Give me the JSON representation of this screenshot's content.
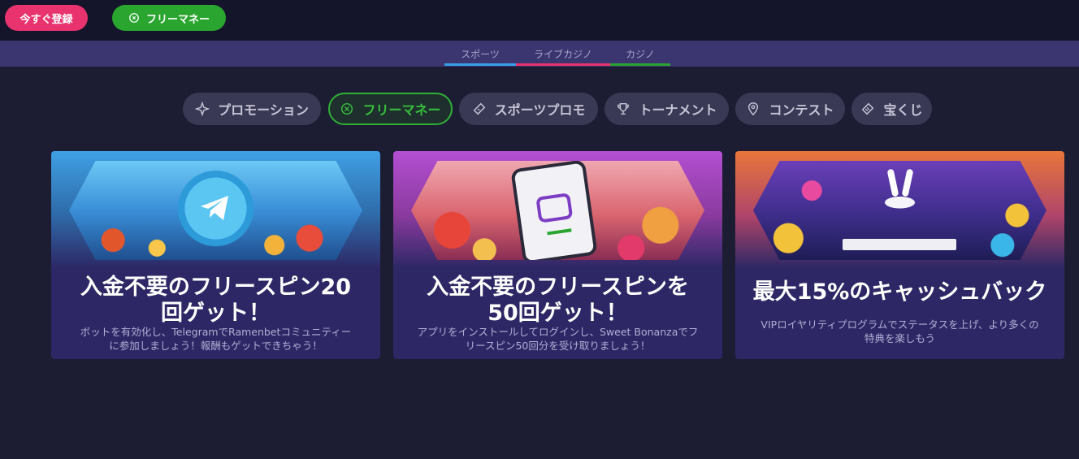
{
  "header": {
    "register_label": "今すぐ登録",
    "freemoney_label": "フリーマネー"
  },
  "nav": {
    "tabs": [
      {
        "label": "スポーツ",
        "color": "#3aa0e8"
      },
      {
        "label": "ライブカジノ",
        "color": "#e8336f"
      },
      {
        "label": "カジノ",
        "color": "#2aa52f"
      }
    ]
  },
  "categories": [
    {
      "label": "プロモーション",
      "icon": "sparkle-icon",
      "active": false
    },
    {
      "label": "フリーマネー",
      "icon": "money-icon",
      "active": true
    },
    {
      "label": "スポーツプロモ",
      "icon": "ticket-icon",
      "active": false
    },
    {
      "label": "トーナメント",
      "icon": "trophy-icon",
      "active": false
    },
    {
      "label": "コンテスト",
      "icon": "pin-icon",
      "active": false
    },
    {
      "label": "宝くじ",
      "icon": "lottery-ticket-icon",
      "active": false
    }
  ],
  "colors": {
    "accent_pink": "#e8336f",
    "accent_green": "#2aa52f",
    "accent_blue": "#3aa0e8",
    "card_bg": "#2d2865",
    "page_bg": "#1c1c33"
  },
  "promos": [
    {
      "title": "入金不要のフリースピン20回ゲット！",
      "title_line1": "入金不要のフリースピン20",
      "title_line2": "回ゲット！",
      "desc_line1": "ボットを有効化し、TelegramでRamenbetコミュニティー",
      "desc_line2": "に参加しましょう！報酬もゲットできちゃう！",
      "image": "telegram-logo-image"
    },
    {
      "title": "入金不要のフリースピンを50回ゲット！",
      "title_line1": "入金不要のフリースピンを",
      "title_line2": "50回ゲット！",
      "desc_line1": "アプリをインストールしてログインし、Sweet Bonanzaでフ",
      "desc_line2": "リースピン50回分を受け取りましょう！",
      "image": "smartphone-app-image"
    },
    {
      "title": "最大15%のキャッシュバック",
      "title_line1": "最大15%のキャッシュバック",
      "desc_line1": "VIPロイヤリティプログラムでステータスを上げ、より多くの",
      "desc_line2": "特典を楽しもう",
      "image": "rabbit-casino-image"
    }
  ]
}
